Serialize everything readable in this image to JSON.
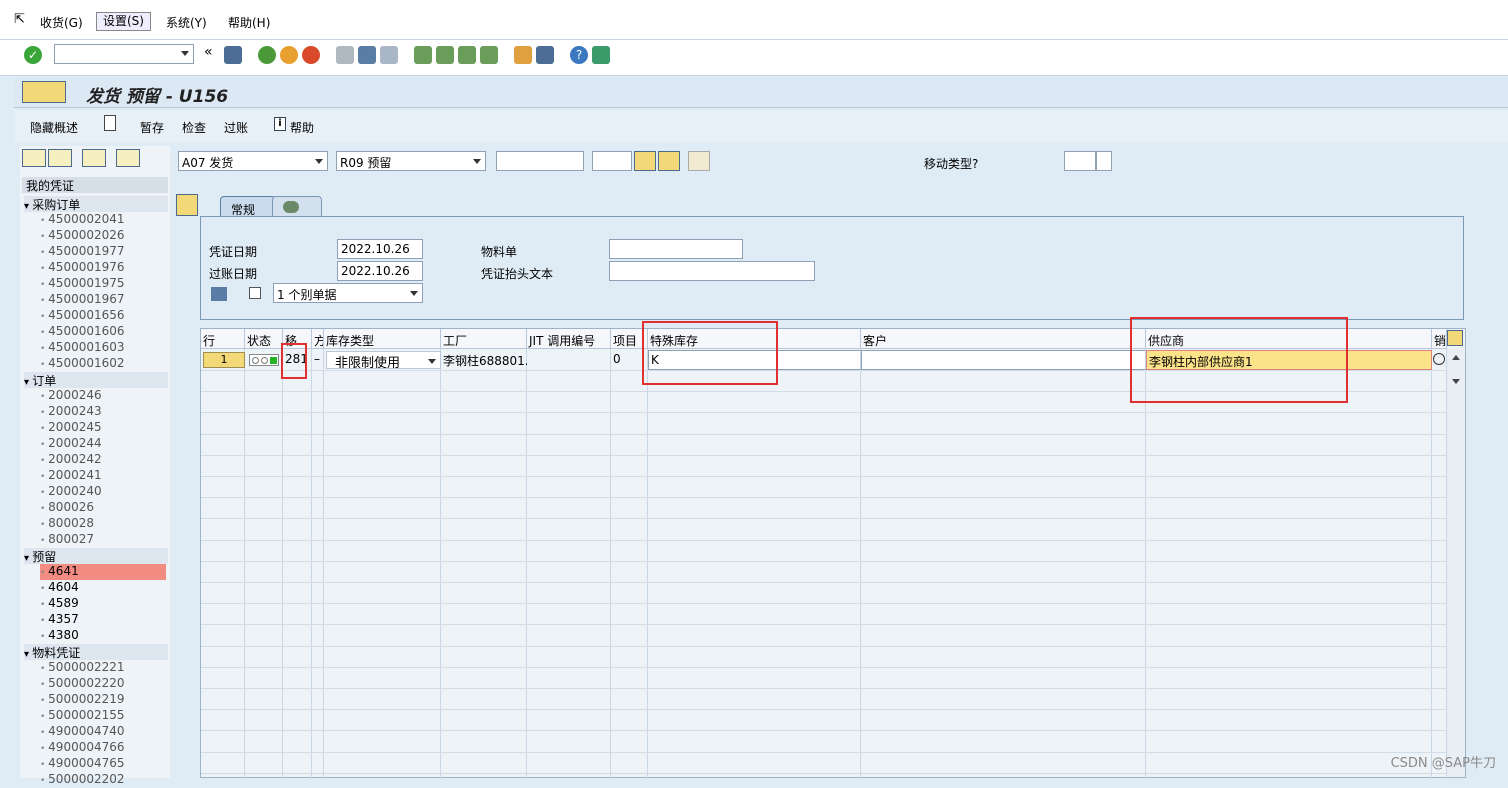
{
  "menu": {
    "items": [
      "收货(G)",
      "设置(S)",
      "系统(Y)",
      "帮助(H)"
    ]
  },
  "title": "发货 预留 - U156",
  "appbar": {
    "hide_overview": "隐藏概述",
    "hold": "暂存",
    "check": "检查",
    "post": "过账",
    "help": "帮助"
  },
  "tree": {
    "header": "我的凭证",
    "folders": [
      {
        "label": "采购订单",
        "items": [
          "4500002041",
          "4500002026",
          "4500001977",
          "4500001976",
          "4500001975",
          "4500001967",
          "4500001656",
          "4500001606",
          "4500001603",
          "4500001602"
        ]
      },
      {
        "label": "订单",
        "items": [
          "2000246",
          "2000243",
          "2000245",
          "2000244",
          "2000242",
          "2000241",
          "2000240",
          "800026",
          "800028",
          "800027"
        ]
      },
      {
        "label": "预留",
        "items": [
          "4641",
          "4604",
          "4589",
          "4357",
          "4380"
        ]
      },
      {
        "label": "物料凭证",
        "items": [
          "5000002221",
          "5000002220",
          "5000002219",
          "5000002155",
          "4900004740",
          "4900004766",
          "4900004765",
          "5000002202"
        ]
      }
    ]
  },
  "selection": {
    "action": "A07 发货",
    "reference": "R09 预留",
    "movement_type_label": "移动类型?"
  },
  "tabs": {
    "general": "常规"
  },
  "header": {
    "doc_date_label": "凭证日期",
    "doc_date": "2022.10.26",
    "post_date_label": "过账日期",
    "post_date": "2022.10.26",
    "bol_label": "物料单",
    "bol_value": "",
    "header_text_label": "凭证抬头文本",
    "header_text_value": "",
    "slip_option": "1 个别单据"
  },
  "grid": {
    "columns": [
      "行",
      "状态",
      "移",
      "方",
      "库存类型",
      "工厂",
      "JIT 调用编号",
      "项目",
      "特殊库存",
      "客户",
      "供应商",
      "销"
    ],
    "row": {
      "line": "1",
      "movement": "281",
      "dash": "–",
      "stock_type": "非限制使用",
      "plant": "李钢柱688801...",
      "jit": "",
      "item": "0",
      "special_stock": "K",
      "customer": "",
      "vendor": "李钢柱内部供应商1"
    }
  },
  "watermark": "CSDN @SAP牛刀"
}
